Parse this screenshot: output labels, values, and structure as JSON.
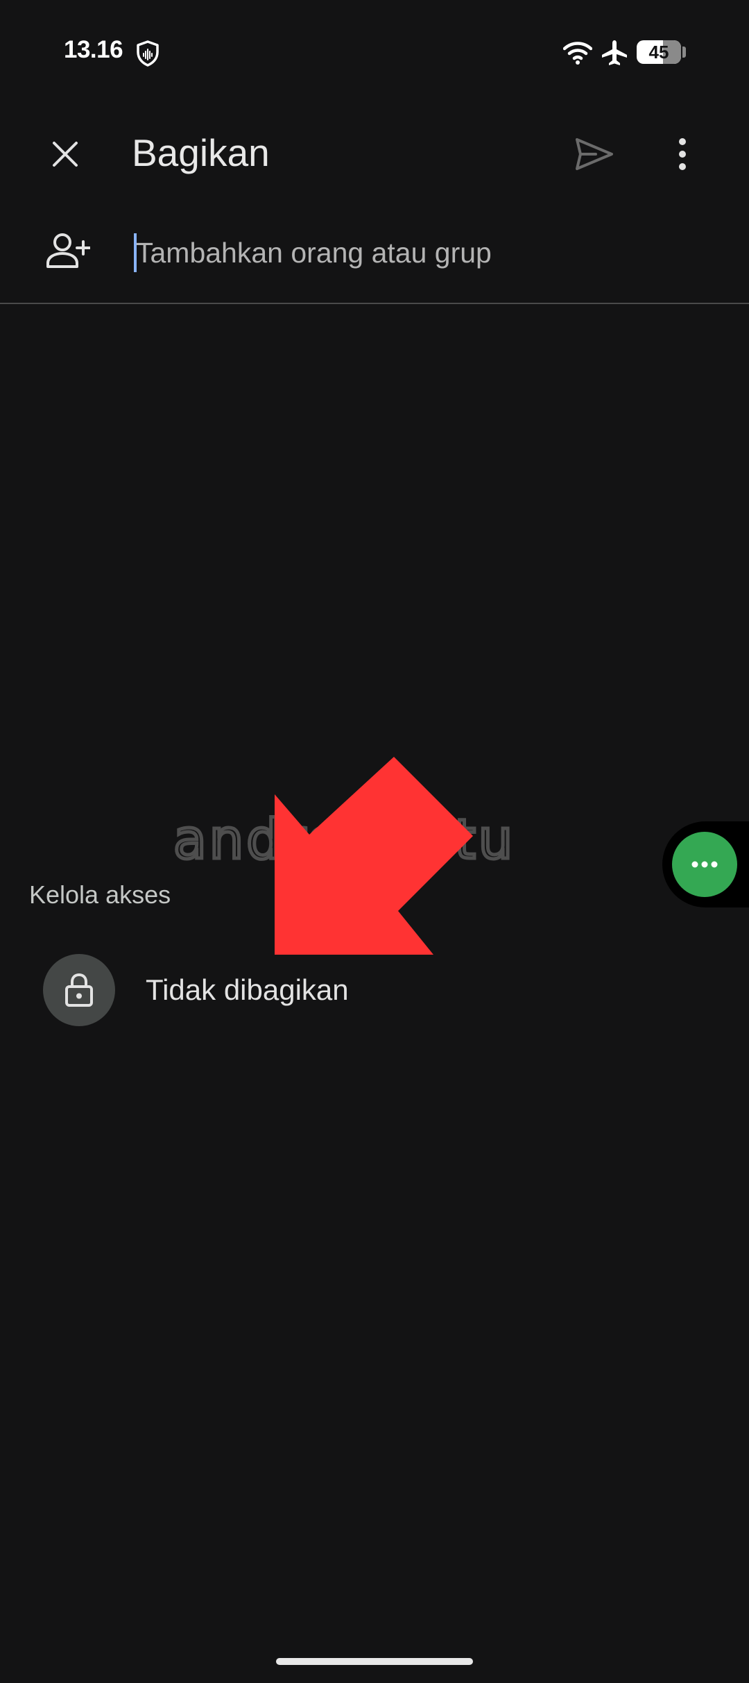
{
  "status_bar": {
    "time": "13.16",
    "battery_level": "45",
    "icons": [
      "shield-icon",
      "wifi-icon",
      "airplane-icon",
      "battery-icon"
    ]
  },
  "app_bar": {
    "title": "Bagikan",
    "close_icon": "close-icon",
    "send_icon": "send-icon",
    "more_icon": "more-vert-icon"
  },
  "add_people": {
    "icon": "person-add-icon",
    "placeholder": "Tambahkan orang atau grup",
    "value": ""
  },
  "watermark": "androbuntu",
  "access_section": {
    "header": "Kelola akses",
    "status_icon": "lock-icon",
    "status_label": "Tidak dibagikan"
  },
  "floating_bubble": {
    "icon": "more-horiz-icon"
  },
  "colors": {
    "background": "#131314",
    "text_primary": "#e3e3e3",
    "text_secondary": "#c4c7c5",
    "caret": "#8ab4f8",
    "annotation_arrow": "#ff3333",
    "bubble_green": "#34a853",
    "avatar_bg": "#444746"
  }
}
